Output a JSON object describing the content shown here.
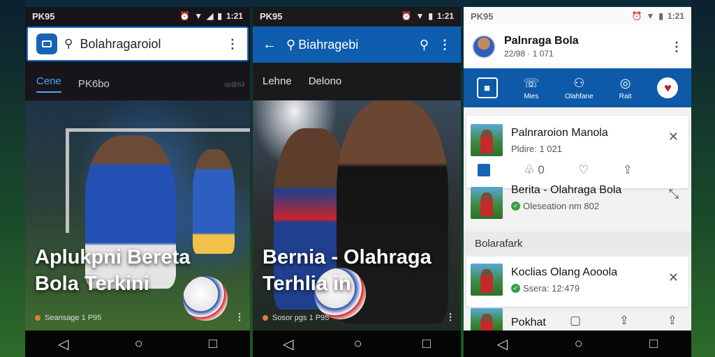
{
  "phone1": {
    "status": {
      "left": "PK95",
      "time": "1:21"
    },
    "search": {
      "query": "Bolahragaroiol"
    },
    "tabs": [
      {
        "label": "Cene"
      },
      {
        "label": "PK6bo"
      },
      {
        "label": "sp@b3"
      }
    ],
    "hero": {
      "headline_line1": "Aplukpni Bereta",
      "headline_line2": "Bola Terkini",
      "source": "Seansage 1 P95"
    }
  },
  "phone2": {
    "status": {
      "left": "PK95",
      "time": "1:21"
    },
    "search": {
      "query": "Biahragebi"
    },
    "tabs": [
      {
        "label": "Lehne"
      },
      {
        "label": "Delono"
      }
    ],
    "hero": {
      "headline_line1": "Bernia - Olahraga",
      "headline_line2": "Terhlia in",
      "source": "Sosor pgs 1 P95"
    }
  },
  "phone3": {
    "status": {
      "left": "PK95",
      "time": "1:21"
    },
    "profile": {
      "name": "Palnraga Bola",
      "date": "22/98 · 1 071"
    },
    "actions": [
      {
        "label": "Mies",
        "icon": "chat-icon"
      },
      {
        "label": "Olahfane",
        "icon": "people-icon"
      },
      {
        "label": "Rait",
        "icon": "alarm-icon"
      },
      {
        "label": "",
        "icon": "heart-badge-icon"
      }
    ],
    "cards": [
      {
        "title": "Palnraroion Manola",
        "meta": "Pldire: 1 021"
      },
      {
        "title": "Berita - Olahraga Bola",
        "meta": "Oleseation nm 802"
      }
    ],
    "reaction_count": "0",
    "section": "Bolarafark",
    "cards2": [
      {
        "title": "Koclias Olang Aooola",
        "meta": "Ssera: 12:479"
      },
      {
        "title": "Pokhat"
      }
    ]
  }
}
